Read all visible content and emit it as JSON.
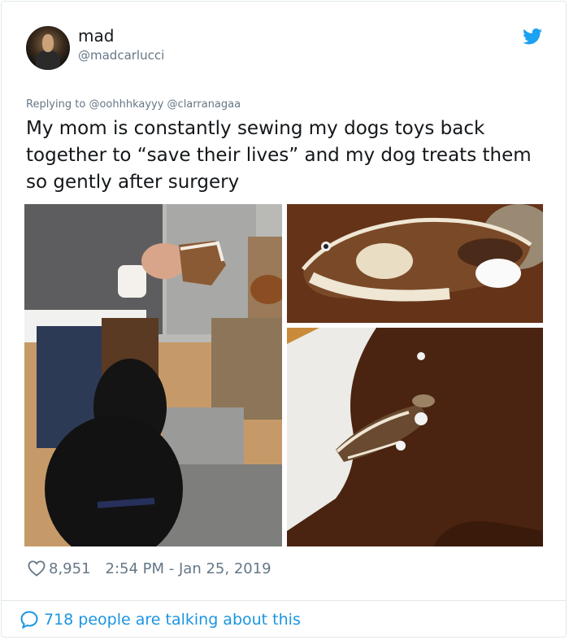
{
  "author": {
    "name": "mad",
    "handle": "@madcarlucci"
  },
  "reply": {
    "prefix": "Replying to",
    "mentions": "@oohhhkayyy @clarranagaa"
  },
  "tweet": {
    "text": "My mom is constantly sewing my dogs toys back together to “save their lives” and my dog treats them so gently after surgery"
  },
  "stats": {
    "likes": "8,951",
    "timestamp": "2:54 PM - Jan 25, 2019"
  },
  "footer": {
    "talking": "718 people are talking about this"
  },
  "colors": {
    "brand": "#1da1f2",
    "link": "#1b95e0",
    "secondary_text": "#657786"
  },
  "icons": {
    "logo": "twitter-bird-icon",
    "like": "heart-icon",
    "reply": "speech-bubble-icon"
  }
}
